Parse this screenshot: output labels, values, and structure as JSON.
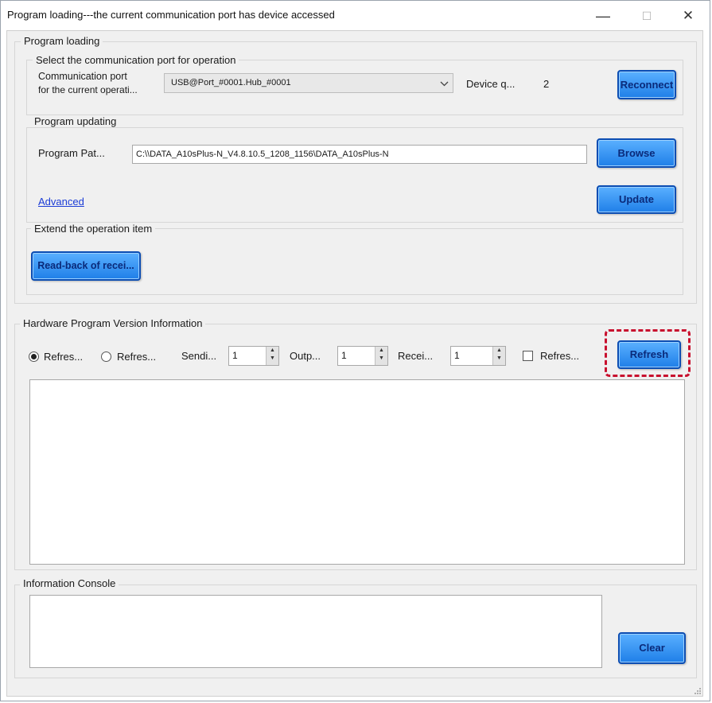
{
  "window": {
    "title": "Program loading---the current communication port has device accessed",
    "minimize_glyph": "—",
    "maximize_glyph": "☐",
    "close_glyph": "✕"
  },
  "program_loading": {
    "group_label": "Program loading",
    "select_port": {
      "group_label": "Select the communication port for operation",
      "port_label_line1": "Communication port",
      "port_label_line2": "for the current operati...",
      "port_value": "USB@Port_#0001.Hub_#0001",
      "device_label": "Device q...",
      "device_count": "2",
      "reconnect_label": "Reconnect"
    },
    "updating": {
      "group_label": "Program updating",
      "path_label": "Program Pat...",
      "path_value": "C:\\\\DATA_A10sPlus-N_V4.8.10.5_1208_1156\\DATA_A10sPlus-N",
      "browse_label": "Browse",
      "advanced_label": "Advanced",
      "update_label": "Update"
    },
    "extend": {
      "group_label": "Extend the operation item",
      "readback_label": "Read-back of recei..."
    }
  },
  "hardware": {
    "group_label": "Hardware Program Version Information",
    "radio1_label": "Refres...",
    "radio2_label": "Refres...",
    "sending_label": "Sendi...",
    "sending_value": "1",
    "output_label": "Outp...",
    "output_value": "1",
    "receiving_label": "Recei...",
    "receiving_value": "1",
    "check_label": "Refres...",
    "refresh_label": "Refresh"
  },
  "console": {
    "group_label": "Information Console",
    "clear_label": "Clear"
  },
  "icons": {
    "dropdown": "chevron-down-icon",
    "spin_up": "▲",
    "spin_down": "▼"
  },
  "colors": {
    "button_gradient_top": "#5ab0ff",
    "button_gradient_bottom": "#1f7fe8",
    "highlight": "#c8102e",
    "link": "#1a3bd6"
  }
}
